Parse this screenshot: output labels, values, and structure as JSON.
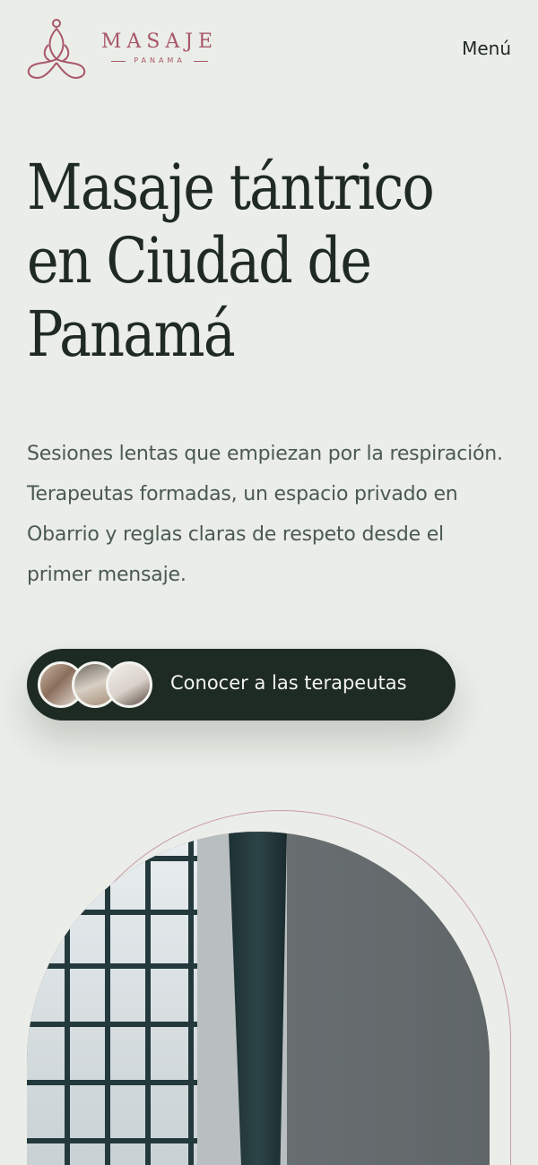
{
  "header": {
    "logo_word": "MASAJE",
    "logo_sub": "PANAMA",
    "menu_label": "Menú"
  },
  "hero": {
    "title_lines": [
      "Masaje tántrico",
      "en Ciudad de",
      "Panamá"
    ],
    "description": "Sesiones lentas que empiezan por la respiración. Terapeutas formadas, un espacio privado en Obarrio y reglas claras de respeto desde el primer mensaje.",
    "cta_label": "Conocer a las terapeutas"
  },
  "colors": {
    "background": "#ebede8",
    "brand_rose": "#a8576a",
    "dark_green": "#1e2b23",
    "text_muted": "#4a5a50"
  }
}
